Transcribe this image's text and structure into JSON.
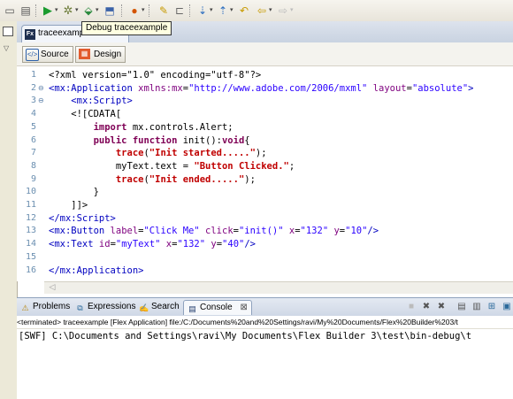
{
  "toolbar": {
    "tooltip": "Debug traceexample"
  },
  "editor_tab": {
    "title": "traceexample.mxml",
    "close": "⊠"
  },
  "mode_bar": {
    "source_label": "Source",
    "design_label": "Design"
  },
  "code_lines": [
    {
      "n": "1",
      "parts": [
        [
          "plain",
          "<?xml version=\"1.0\" encoding=\"utf-8\"?>"
        ]
      ]
    },
    {
      "n": "2",
      "fold": "⊖",
      "parts": [
        [
          "tag",
          "<mx:Application"
        ],
        [
          "plain",
          " "
        ],
        [
          "attr",
          "xmlns:mx"
        ],
        [
          "plain",
          "="
        ],
        [
          "str",
          "\"http://www.adobe.com/2006/mxml\""
        ],
        [
          "plain",
          " "
        ],
        [
          "attr",
          "layout"
        ],
        [
          "plain",
          "="
        ],
        [
          "str",
          "\"absolute\""
        ],
        [
          "tag",
          ">"
        ]
      ]
    },
    {
      "n": "3",
      "fold": "⊖",
      "parts": [
        [
          "plain",
          "    "
        ],
        [
          "tag",
          "<mx:Script>"
        ]
      ]
    },
    {
      "n": "4",
      "parts": [
        [
          "plain",
          "    <![CDATA["
        ]
      ]
    },
    {
      "n": "5",
      "parts": [
        [
          "plain",
          "        "
        ],
        [
          "kw",
          "import"
        ],
        [
          "plain",
          " mx.controls.Alert;"
        ]
      ]
    },
    {
      "n": "6",
      "parts": [
        [
          "plain",
          "        "
        ],
        [
          "kw",
          "public function"
        ],
        [
          "plain",
          " init():"
        ],
        [
          "kw",
          "void"
        ],
        [
          "plain",
          "{"
        ]
      ]
    },
    {
      "n": "7",
      "parts": [
        [
          "plain",
          "            "
        ],
        [
          "fnstr",
          "trace"
        ],
        [
          "plain",
          "("
        ],
        [
          "fnstr",
          "\"Init started.....\""
        ],
        [
          "plain",
          ");"
        ]
      ]
    },
    {
      "n": "8",
      "parts": [
        [
          "plain",
          "            myText.text = "
        ],
        [
          "fnstr",
          "\"Button Clicked.\""
        ],
        [
          "plain",
          ";"
        ]
      ]
    },
    {
      "n": "9",
      "parts": [
        [
          "plain",
          "            "
        ],
        [
          "fnstr",
          "trace"
        ],
        [
          "plain",
          "("
        ],
        [
          "fnstr",
          "\"Init ended.....\""
        ],
        [
          "plain",
          ");"
        ]
      ]
    },
    {
      "n": "10",
      "parts": [
        [
          "plain",
          "        }"
        ]
      ]
    },
    {
      "n": "11",
      "parts": [
        [
          "plain",
          "    ]]>"
        ]
      ]
    },
    {
      "n": "12",
      "parts": [
        [
          "tag",
          "</mx:Script>"
        ]
      ]
    },
    {
      "n": "13",
      "parts": [
        [
          "tag",
          "<mx:Button"
        ],
        [
          "plain",
          " "
        ],
        [
          "attr",
          "label"
        ],
        [
          "plain",
          "="
        ],
        [
          "str",
          "\"Click Me\""
        ],
        [
          "plain",
          " "
        ],
        [
          "attr",
          "click"
        ],
        [
          "plain",
          "="
        ],
        [
          "str",
          "\"init()\""
        ],
        [
          "plain",
          " "
        ],
        [
          "attr",
          "x"
        ],
        [
          "plain",
          "="
        ],
        [
          "str",
          "\"132\""
        ],
        [
          "plain",
          " "
        ],
        [
          "attr",
          "y"
        ],
        [
          "plain",
          "="
        ],
        [
          "str",
          "\"10\""
        ],
        [
          "tag",
          "/>"
        ]
      ]
    },
    {
      "n": "14",
      "parts": [
        [
          "tag",
          "<mx:Text"
        ],
        [
          "plain",
          " "
        ],
        [
          "attr",
          "id"
        ],
        [
          "plain",
          "="
        ],
        [
          "str",
          "\"myText\""
        ],
        [
          "plain",
          " "
        ],
        [
          "attr",
          "x"
        ],
        [
          "plain",
          "="
        ],
        [
          "str",
          "\"132\""
        ],
        [
          "plain",
          " "
        ],
        [
          "attr",
          "y"
        ],
        [
          "plain",
          "="
        ],
        [
          "str",
          "\"40\""
        ],
        [
          "tag",
          "/>"
        ]
      ]
    },
    {
      "n": "15",
      "parts": []
    },
    {
      "n": "16",
      "parts": [
        [
          "tag",
          "</mx:Application>"
        ]
      ]
    }
  ],
  "panel": {
    "tabs": [
      "Problems",
      "Expressions",
      "Search",
      "Console"
    ],
    "console_close": "⊠",
    "terminated_text": "<terminated> traceexample [Flex Application] file:/C:/Documents%20and%20Settings/ravi/My%20Documents/Flex%20Builder%203/t",
    "console_output": "[SWF] C:\\Documents and Settings\\ravi\\My Documents\\Flex Builder 3\\test\\bin-debug\\t"
  },
  "colors": {
    "tag": "#0000c0",
    "attribute": "#7f007f",
    "string": "#2a00ff",
    "keyword": "#7f0055",
    "trace_string": "#c00000"
  }
}
